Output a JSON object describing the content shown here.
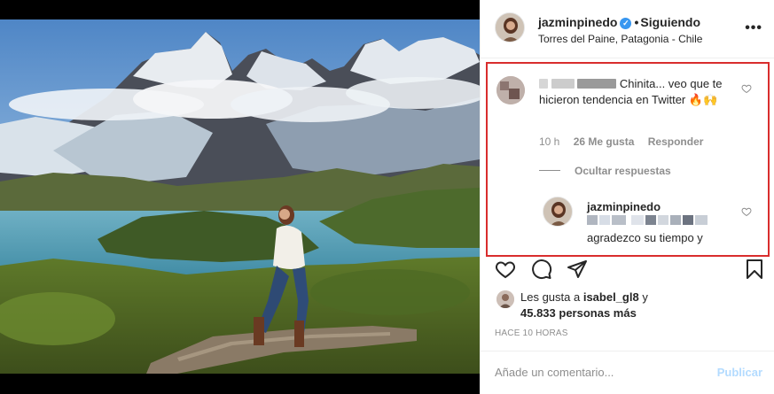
{
  "post": {
    "username": "jazminpinedo",
    "verified_glyph": "✓",
    "separator": "•",
    "follow_status": "Siguiendo",
    "location": "Torres del Paine, Patagonia - Chile"
  },
  "comment": {
    "text_line": "Chinita... veo que te hicieron tendencia en Twitter 🔥🙌",
    "time": "10 h",
    "likes": "26 Me gusta",
    "reply": "Responder",
    "hide_replies": "Ocultar respuestas"
  },
  "reply": {
    "username": "jazminpinedo",
    "text": "agradezco su tiempo y"
  },
  "likes": {
    "prefix": "Les gusta a",
    "user": "isabel_gl8",
    "conj": "y",
    "others": "45.833 personas más"
  },
  "timestamp": "HACE 10 HORAS",
  "composer": {
    "placeholder": "Añade un comentario...",
    "submit": "Publicar"
  },
  "icons": {
    "more": "more-options-icon",
    "like": "heart-icon",
    "comment": "comment-icon",
    "share": "share-icon",
    "save": "bookmark-icon"
  },
  "colors": {
    "highlight": "#d92d2d",
    "verified": "#3897f0",
    "publish_disabled": "#b3dbff"
  }
}
